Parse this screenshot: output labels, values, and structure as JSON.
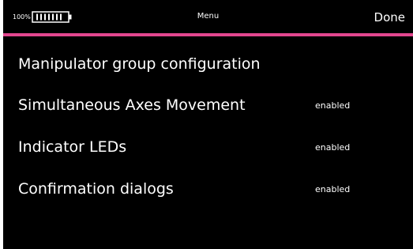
{
  "colors": {
    "background": "#000000",
    "text": "#ffffff",
    "accent": "#e2468e"
  },
  "status_bar": {
    "battery_percent_label": "100%",
    "battery_level": 1.0,
    "battery_icon": "battery-full-icon",
    "title": "Menu",
    "done_label": "Done"
  },
  "page": {
    "title": "Manipulator group configuration"
  },
  "settings": [
    {
      "label": "Simultaneous Axes Movement",
      "value": "enabled"
    },
    {
      "label": "Indicator LEDs",
      "value": "enabled"
    },
    {
      "label": "Confirmation dialogs",
      "value": "enabled"
    }
  ]
}
